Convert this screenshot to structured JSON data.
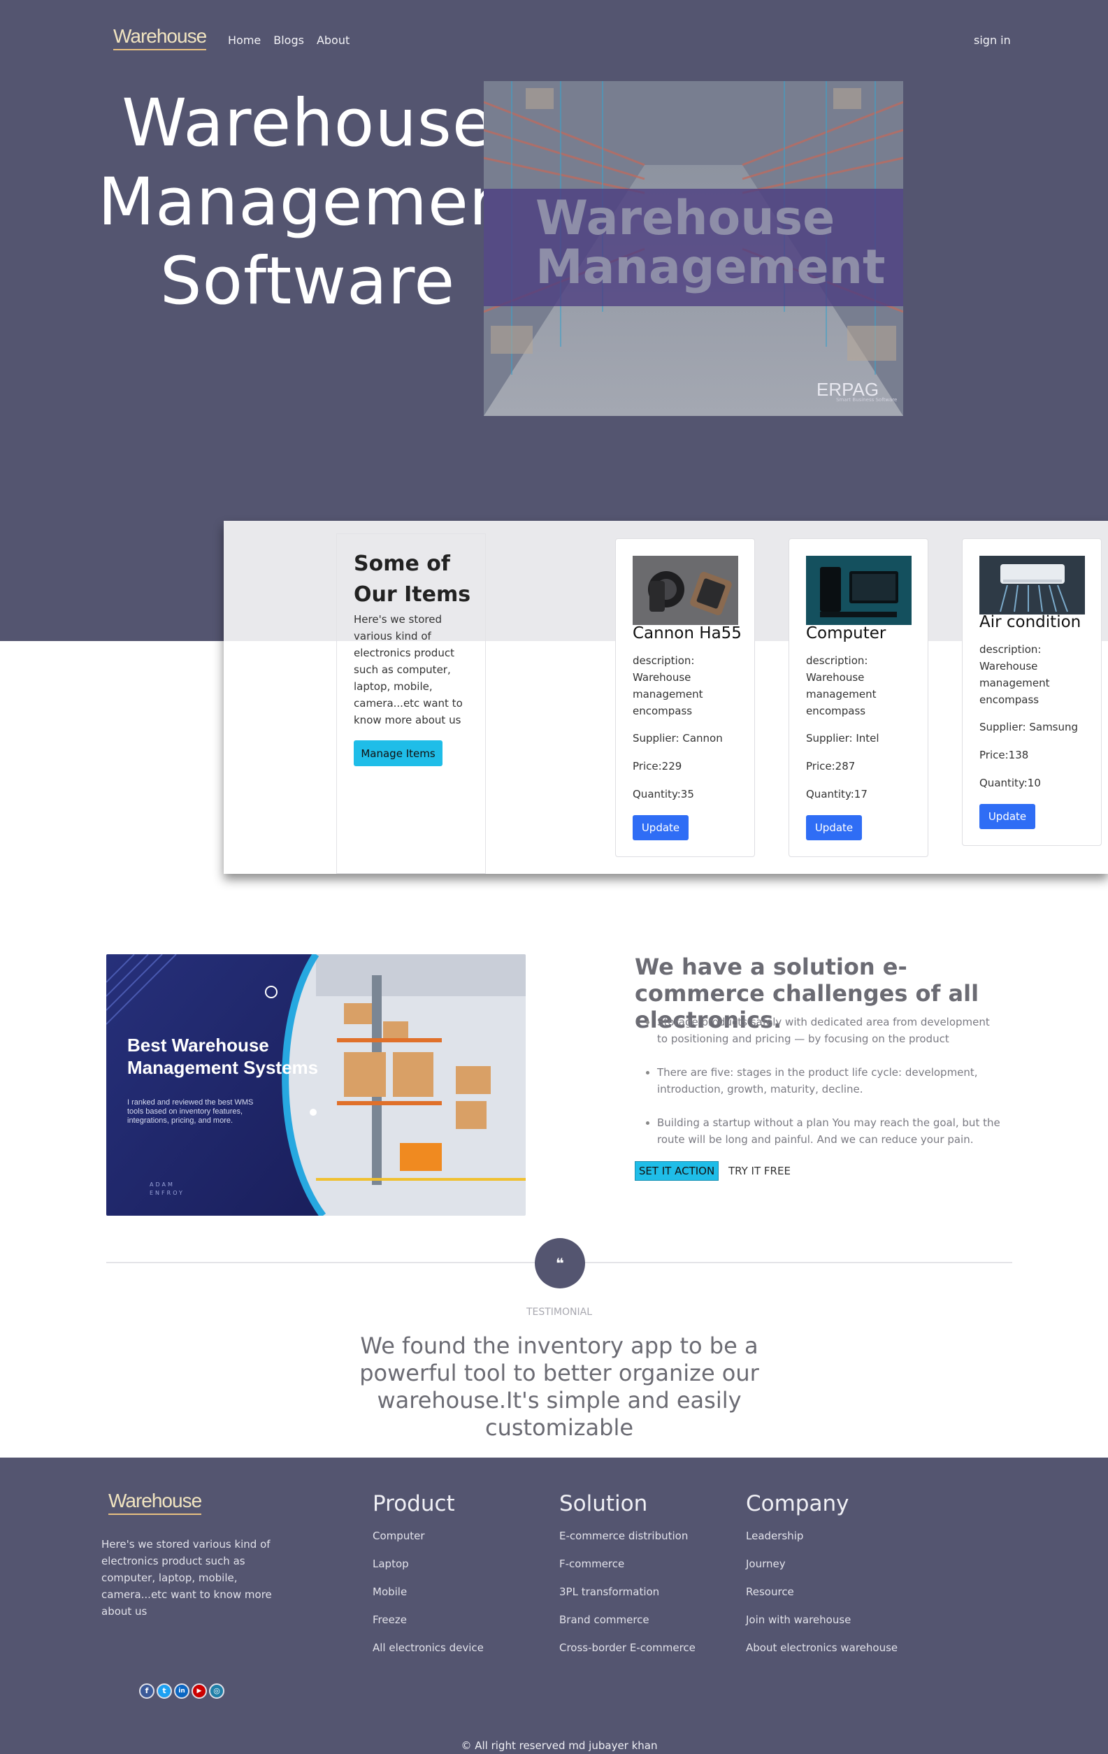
{
  "nav": {
    "logo": "Warehouse",
    "links": [
      "Home",
      "Blogs",
      "About"
    ],
    "signin": "sign in"
  },
  "hero": {
    "title_lines": [
      "Warehouse",
      "Management",
      "Software"
    ],
    "image_text_lines": [
      "Warehouse",
      "Management"
    ],
    "image_brand": "ERPAG",
    "image_brand_sub": "Smart Business Software"
  },
  "items": {
    "title_lines": [
      "Some of",
      "Our Items"
    ],
    "description": "Here's we stored various kind of electronics product such as computer, laptop, mobile, camera...etc want to know more about us",
    "manage_button": "Manage Items",
    "cards": [
      {
        "name": "Cannon Ha55",
        "description": "description: Warehouse management encompass",
        "supplier": "Supplier: Cannon",
        "price": "Price:229",
        "quantity": "Quantity:35",
        "button": "Update"
      },
      {
        "name": "Computer",
        "description": "description: Warehouse management encompass",
        "supplier": "Supplier: Intel",
        "price": "Price:287",
        "quantity": "Quantity:17",
        "button": "Update"
      },
      {
        "name": "Air condition",
        "description": "description: Warehouse management encompass",
        "supplier": "Supplier: Samsung",
        "price": "Price:138",
        "quantity": "Quantity:10",
        "button": "Update"
      }
    ]
  },
  "solution": {
    "image_title_lines": [
      "Best Warehouse",
      "Management Systems"
    ],
    "image_caption": "I ranked and reviewed the best WMS tools based on inventory features, integrations, pricing, and more.",
    "image_brand": "ADAM ENFROY",
    "title": "We have a solution e-commerce challenges of all electronics.",
    "points": [
      "Storage products safely with dedicated area from development to positioning and pricing — by focusing on the product",
      "There are five: stages in the product life cycle: development, introduction, growth, maturity, decline.",
      "Building a startup without a plan You may reach the goal, but the route will be long and painful. And we can reduce your pain."
    ],
    "action_button": "SET IT ACTION",
    "free_button": "TRY IT FREE"
  },
  "testimonial": {
    "quote_mark": "❝",
    "label": "TESTIMONIAL",
    "text": "We found the inventory app to be a powerful tool to better organize our warehouse.It's simple and easily customizable"
  },
  "footer": {
    "logo": "Warehouse",
    "description": "Here's we stored various kind of electronics product such as computer, laptop, mobile, camera...etc want to know more about us",
    "columns": [
      {
        "title": "Product",
        "links": [
          "Computer",
          "Laptop",
          "Mobile",
          "Freeze",
          "All electronics device"
        ]
      },
      {
        "title": "Solution",
        "links": [
          "E-commerce distribution",
          "F-commerce",
          "3PL transformation",
          "Brand commerce",
          "Cross-border E-commerce"
        ]
      },
      {
        "title": "Company",
        "links": [
          "Leadership",
          "Journey",
          "Resource",
          "Join with warehouse",
          "About electronics warehouse"
        ]
      }
    ],
    "socials": [
      {
        "name": "facebook-icon",
        "glyph": "f",
        "color": "#3b5998"
      },
      {
        "name": "twitter-icon",
        "glyph": "t",
        "color": "#1da1f2"
      },
      {
        "name": "linkedin-icon",
        "glyph": "in",
        "color": "#0a66c2"
      },
      {
        "name": "youtube-icon",
        "glyph": "▶",
        "color": "#cc0000"
      },
      {
        "name": "instagram-icon",
        "glyph": "◎",
        "color": "#1f7fa8"
      }
    ],
    "copyright": "© All right reserved md jubayer khan"
  },
  "colors": {
    "header_bg": "#545570",
    "accent_cyan": "#1fbde8",
    "accent_blue": "#2f6df5",
    "logo": "#f1e4c0"
  }
}
